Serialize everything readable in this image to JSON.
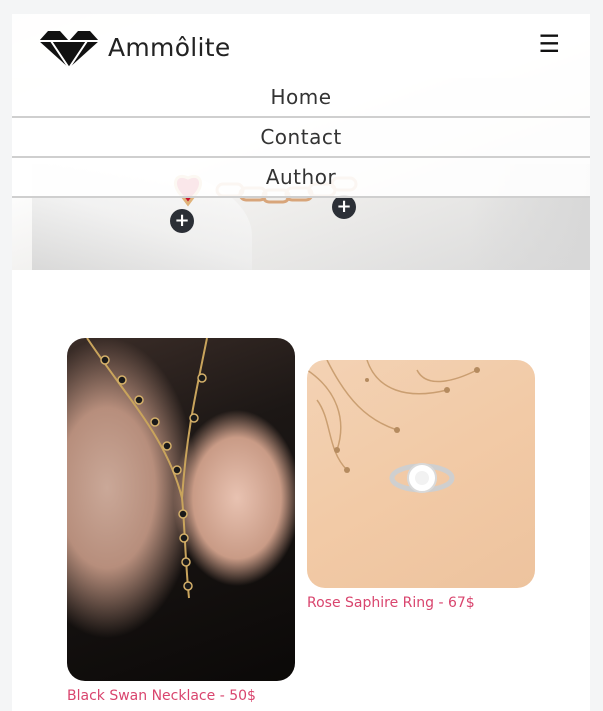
{
  "brand": {
    "name": "Ammôlite",
    "logo_icon": "diamond-icon"
  },
  "header": {
    "menu_icon": "hamburger-icon",
    "menu_glyph": "☰"
  },
  "nav": {
    "items": [
      {
        "label": "Home"
      },
      {
        "label": "Contact"
      },
      {
        "label": "Author"
      }
    ]
  },
  "hero": {
    "plus_glyph": "+"
  },
  "products": [
    {
      "label": "Black Swan Necklace - 50$"
    },
    {
      "label": "Rose Saphire Ring - 67$"
    }
  ],
  "colors": {
    "accent": "#d9456e",
    "button_dark": "#2b2f36"
  }
}
